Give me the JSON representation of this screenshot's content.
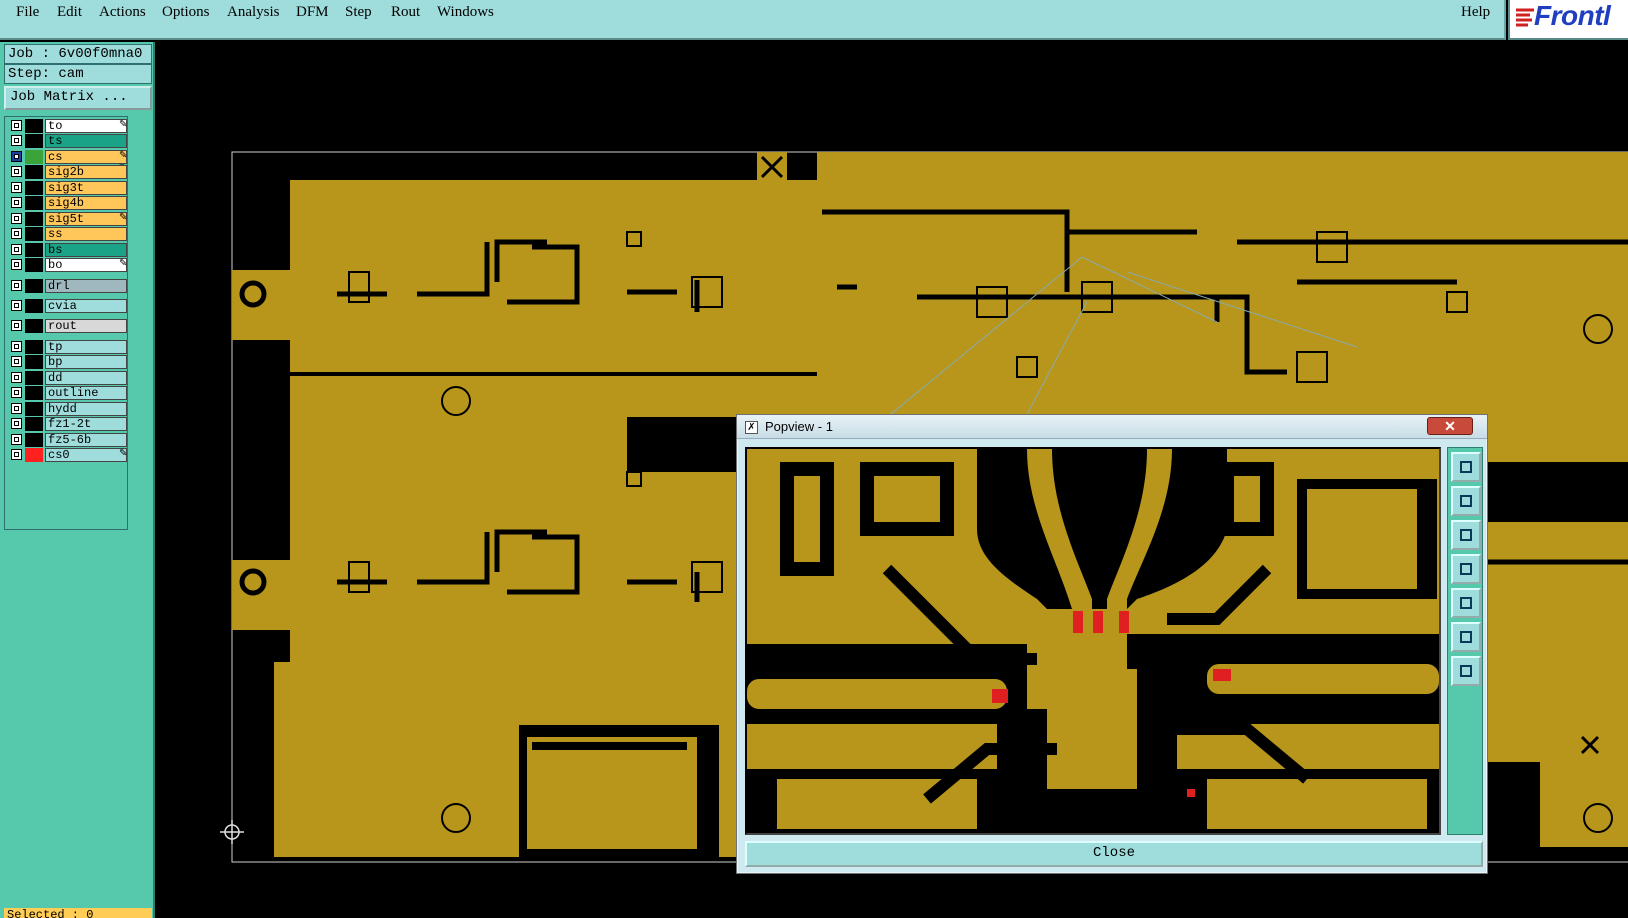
{
  "menu": {
    "items": [
      "File",
      "Edit",
      "Actions",
      "Options",
      "Analysis",
      "DFM",
      "Step",
      "Rout",
      "Windows"
    ],
    "help": "Help",
    "logo": "Frontl"
  },
  "sidebar": {
    "job": "Job : 6v00f0mna0",
    "step": "Step: cam",
    "job_matrix": "Job Matrix ...",
    "layers": [
      {
        "name": "to",
        "bg": "#ffffff",
        "flag": "✎",
        "swatch": "#000000",
        "checked": false
      },
      {
        "name": "ts",
        "bg": "#1aa386",
        "flag": "",
        "swatch": "#000000",
        "checked": false
      },
      {
        "name": "cs",
        "bg": "#ffc65a",
        "flag": "✎ ≡",
        "swatch": "#3aa33a",
        "checked": true
      },
      {
        "name": "sig2b",
        "bg": "#ffc65a",
        "flag": "",
        "swatch": "#000000",
        "checked": false
      },
      {
        "name": "sig3t",
        "bg": "#ffc65a",
        "flag": "",
        "swatch": "#000000",
        "checked": false
      },
      {
        "name": "sig4b",
        "bg": "#ffc65a",
        "flag": "",
        "swatch": "#000000",
        "checked": false
      },
      {
        "name": "sig5t",
        "bg": "#ffc65a",
        "flag": "✎",
        "swatch": "#000000",
        "checked": false
      },
      {
        "name": "ss",
        "bg": "#ffc65a",
        "flag": "",
        "swatch": "#000000",
        "checked": false
      },
      {
        "name": "bs",
        "bg": "#1aa386",
        "flag": "",
        "swatch": "#000000",
        "checked": false
      },
      {
        "name": "bo",
        "bg": "#ffffff",
        "flag": "✎",
        "swatch": "#000000",
        "checked": false
      },
      {
        "name": "drl",
        "bg": "#9fb8c0",
        "flag": "",
        "swatch": "#000000",
        "checked": false
      },
      {
        "name": "cvia",
        "bg": "#9fdcdc",
        "flag": "",
        "swatch": "#000000",
        "checked": false
      },
      {
        "name": "rout",
        "bg": "#d8d8d8",
        "flag": "",
        "swatch": "#000000",
        "checked": false
      },
      {
        "name": "tp",
        "bg": "#9fdcdc",
        "flag": "",
        "swatch": "#000000",
        "checked": false
      },
      {
        "name": "bp",
        "bg": "#9fdcdc",
        "flag": "",
        "swatch": "#000000",
        "checked": false
      },
      {
        "name": "dd",
        "bg": "#9fdcdc",
        "flag": "",
        "swatch": "#000000",
        "checked": false
      },
      {
        "name": "outline",
        "bg": "#9fdcdc",
        "flag": "",
        "swatch": "#000000",
        "checked": false
      },
      {
        "name": "hydd",
        "bg": "#9fdcdc",
        "flag": "",
        "swatch": "#000000",
        "checked": false
      },
      {
        "name": "fz1-2t",
        "bg": "#9fdcdc",
        "flag": "",
        "swatch": "#000000",
        "checked": false
      },
      {
        "name": "fz5-6b",
        "bg": "#9fdcdc",
        "flag": "",
        "swatch": "#000000",
        "checked": false
      },
      {
        "name": "cs0",
        "bg": "#9fdcdc",
        "flag": "✎",
        "swatch": "#ff2020",
        "checked": false
      }
    ],
    "selected": "Selected : 0"
  },
  "popview": {
    "title": "Popview - 1",
    "close_x": "✕",
    "close": "Close",
    "tools": [
      "zoom-window-icon",
      "pan-up-icon",
      "pan-down-icon",
      "pan-left-icon",
      "pan-right-icon",
      "zoom-fit-icon",
      "zoom-home-icon"
    ]
  },
  "colors": {
    "copper": "#b8961c",
    "board_bg": "#000000",
    "panel": "#56c8ab",
    "menu": "#9fdcdc"
  }
}
